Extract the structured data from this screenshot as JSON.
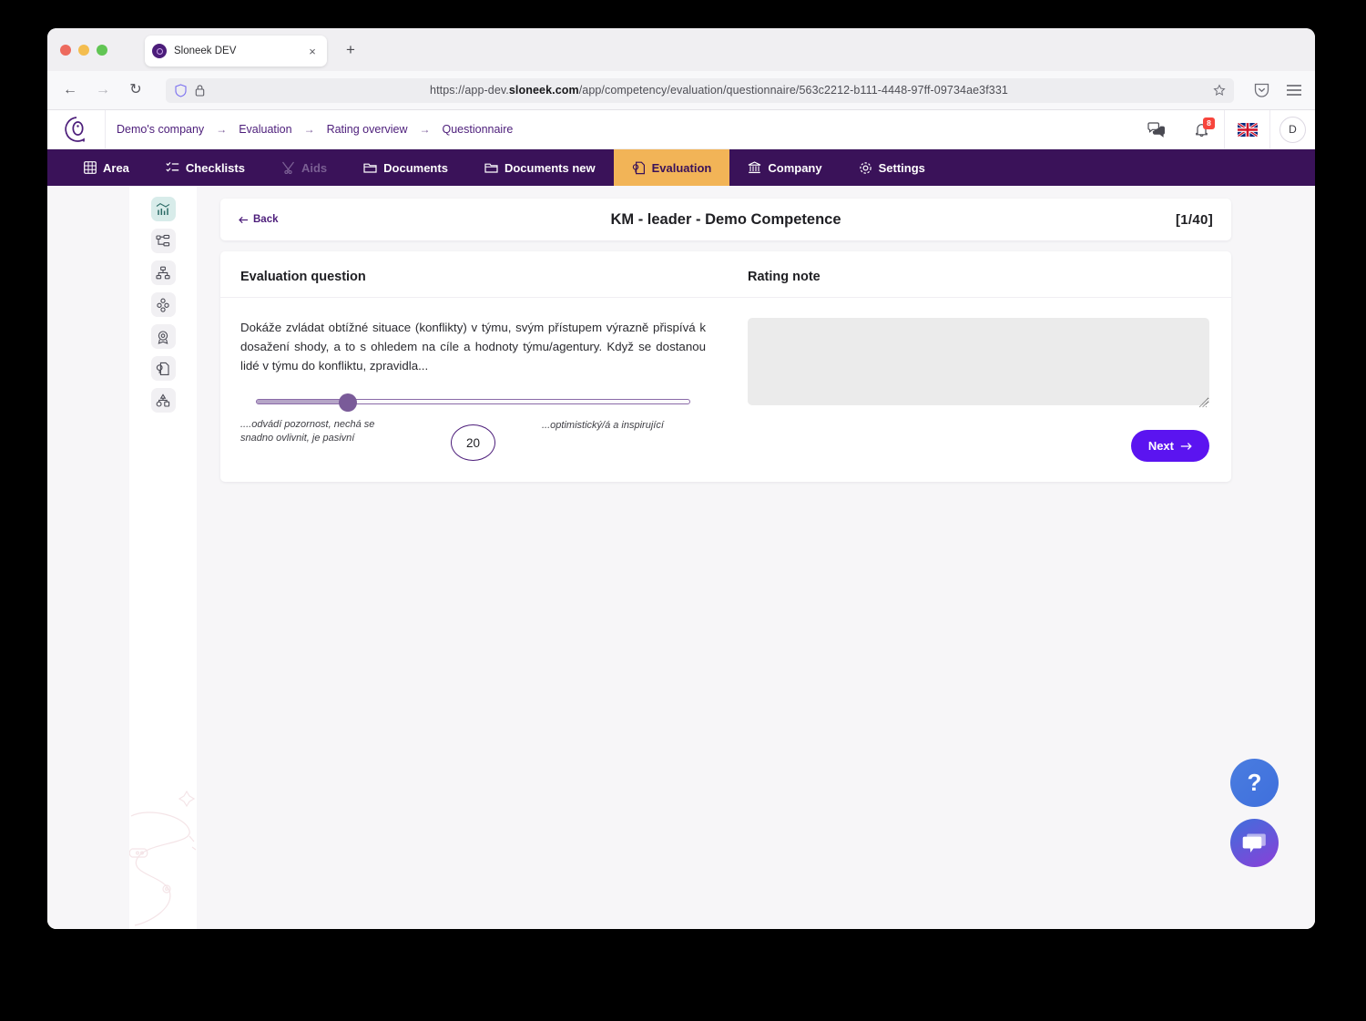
{
  "browser": {
    "tab": {
      "title": "Sloneek DEV",
      "close_label": "×",
      "favicon": "sloneek-logo-icon"
    },
    "new_tab_label": "+",
    "nav": {
      "back": "←",
      "forward": "→",
      "reload": "↻"
    },
    "url": {
      "prefix": "https://app-dev.",
      "domain": "sloneek.com",
      "path": "/app/competency/evaluation/questionnaire/563c2212-b111-4448-97ff-09734ae3f331",
      "full": "https://app-dev.sloneek.com/app/competency/evaluation/questionnaire/563c2212-b111-4448-97ff-09734ae3f331"
    },
    "toolbar_icons": [
      "shield-icon",
      "lock-icon",
      "bookmark-star-icon",
      "pocket-icon",
      "menu-icon"
    ]
  },
  "header": {
    "logo": "sloneek-logo",
    "breadcrumb": [
      {
        "label": "Demo's company"
      },
      {
        "label": "Evaluation"
      },
      {
        "label": "Rating overview"
      },
      {
        "label": "Questionnaire"
      }
    ],
    "crumb_separator": "→",
    "icons": {
      "chat": "chat-bubbles-icon",
      "bell": "bell-icon",
      "notification_count": "8",
      "language": "uk-flag-icon",
      "avatar_initial": "D"
    }
  },
  "nav": {
    "items": [
      {
        "label": "Area",
        "icon": "grid-icon",
        "state": "normal"
      },
      {
        "label": "Checklists",
        "icon": "checklist-icon",
        "state": "normal"
      },
      {
        "label": "Aids",
        "icon": "tools-icon",
        "state": "disabled"
      },
      {
        "label": "Documents",
        "icon": "folder-icon",
        "state": "normal"
      },
      {
        "label": "Documents new",
        "icon": "folder-icon",
        "state": "normal"
      },
      {
        "label": "Evaluation",
        "icon": "evaluation-icon",
        "state": "active"
      },
      {
        "label": "Company",
        "icon": "bank-icon",
        "state": "normal"
      },
      {
        "label": "Settings",
        "icon": "gear-icon",
        "state": "normal"
      }
    ],
    "colors": {
      "bar": "#3A1259",
      "active_bg": "#F2B457",
      "active_text": "#3A1259"
    }
  },
  "sidebar": {
    "items": [
      {
        "icon": "bar-chart-icon",
        "active": true
      },
      {
        "icon": "tree-structure-icon",
        "active": false
      },
      {
        "icon": "org-chart-icon",
        "active": false
      },
      {
        "icon": "people-group-icon",
        "active": false
      },
      {
        "icon": "target-badge-icon",
        "active": false
      },
      {
        "icon": "document-search-icon",
        "active": false
      },
      {
        "icon": "hierarchy-icon",
        "active": false
      }
    ],
    "decoration": "pink-swirl-illustration"
  },
  "card": {
    "back_label": "Back",
    "back_icon": "arrow-left-icon",
    "title": "KM - leader - Demo Competence",
    "counter": "[1/40]"
  },
  "question_panel": {
    "heading": "Evaluation question",
    "text": "Dokáže zvládat obtížné situace (konflikty) v týmu, svým přístupem výrazně přispívá k dosažení shody, a to s ohledem na cíle a hodnoty týmu/agentury. Když se dostanou lidé v týmu do konfliktu, zpravidla...",
    "slider": {
      "value": "20",
      "min": 0,
      "max": 100,
      "label_low": "....odvádí pozornost, nechá se snadno ovlivnit, je pasivní",
      "label_high": "...optimistický/á a inspirující",
      "accent": "#7A5B99"
    }
  },
  "note_panel": {
    "heading": "Rating note",
    "value": "",
    "placeholder": ""
  },
  "footer": {
    "next_label": "Next",
    "next_icon": "arrow-right-icon",
    "next_color": "#5B14F0"
  },
  "floating": {
    "help_label": "?",
    "help_name": "help-fab",
    "chat_name": "chat-fab"
  }
}
